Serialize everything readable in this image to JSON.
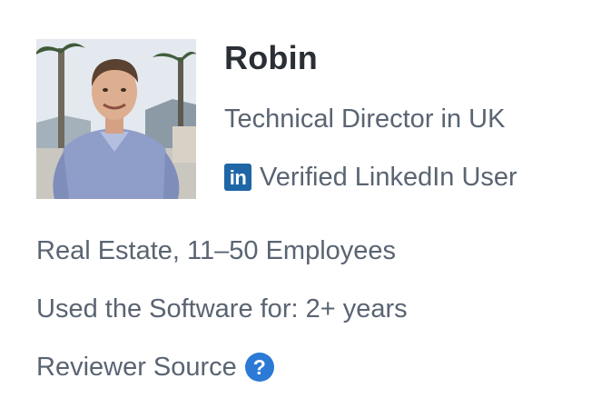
{
  "reviewer": {
    "name": "Robin",
    "title": "Technical Director in UK",
    "verified_label": "Verified LinkedIn User",
    "linkedin_glyph": "in",
    "industry_size": "Real Estate, 11–50 Employees",
    "usage_duration": "Used the Software for: 2+ years",
    "source_label": "Reviewer Source",
    "help_glyph": "?"
  },
  "icons": {
    "linkedin": "linkedin-icon",
    "help": "question-circle-icon"
  },
  "colors": {
    "linkedin_blue": "#1e66a6",
    "help_blue": "#2c7ad6",
    "name_text": "#2a2f36",
    "secondary_text": "#5a6472"
  }
}
